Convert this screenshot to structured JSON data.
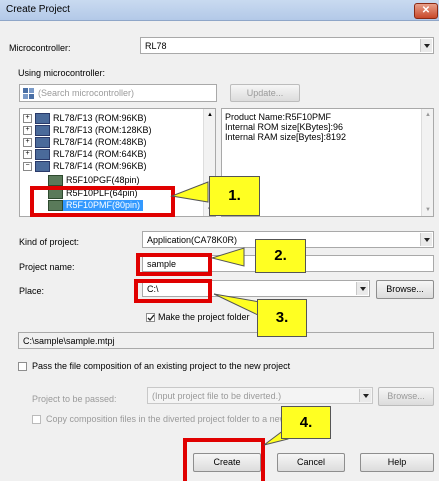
{
  "window": {
    "title": "Create Project",
    "close_glyph": "✕"
  },
  "microcontroller": {
    "label": "Microcontroller:",
    "value": "RL78"
  },
  "using_mc": {
    "label": "Using microcontroller:",
    "search_placeholder": "(Search microcontroller)",
    "update_label": "Update..."
  },
  "tree": {
    "items": [
      {
        "expander": "+",
        "label": "RL78/F13 (ROM:96KB)"
      },
      {
        "expander": "+",
        "label": "RL78/F13 (ROM:128KB)"
      },
      {
        "expander": "+",
        "label": "RL78/F14 (ROM:48KB)"
      },
      {
        "expander": "+",
        "label": "RL78/F14 (ROM:64KB)"
      },
      {
        "expander": "−",
        "label": "RL78/F14 (ROM:96KB)"
      }
    ],
    "children": [
      {
        "label": "R5F10PGF(48pin)"
      },
      {
        "label": "R5F10PLF(64pin)"
      },
      {
        "label": "R5F10PMF(80pin)"
      }
    ]
  },
  "product_info": {
    "lines": [
      "Product Name:R5F10PMF",
      "Internal ROM size[KBytes]:96",
      "Internal RAM size[Bytes]:8192"
    ]
  },
  "kind": {
    "label": "Kind of project:",
    "value": "Application(CA78K0R)"
  },
  "project_name": {
    "label": "Project name:",
    "value": "sample"
  },
  "place": {
    "label": "Place:",
    "value": "C:\\",
    "browse_label": "Browse..."
  },
  "make_folder": {
    "label": "Make the project folder",
    "checked": true
  },
  "path_display": "C:\\sample\\sample.mtpj",
  "pass_composition": {
    "label": "Pass the file composition of an existing project to the new project",
    "checked": false
  },
  "project_to_pass": {
    "label": "Project to be passed:",
    "placeholder": "(Input project file to be diverted.)",
    "browse_label": "Browse..."
  },
  "copy_files": {
    "label": "Copy composition files in the diverted project folder to a new p"
  },
  "buttons": {
    "create": "Create",
    "cancel": "Cancel",
    "help": "Help"
  },
  "callouts": [
    "1.",
    "2.",
    "3.",
    "4."
  ],
  "colors": {
    "highlight": "#e00000",
    "callout": "#ffff22",
    "selection": "#3399ff"
  }
}
